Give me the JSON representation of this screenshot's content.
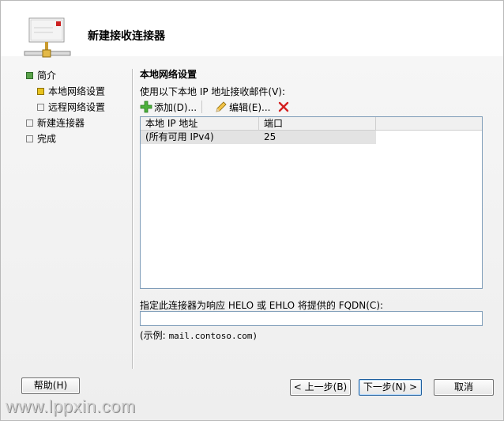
{
  "header": {
    "title": "新建接收连接器"
  },
  "nav": {
    "items": [
      {
        "label": "简介",
        "state": "complete"
      },
      {
        "label": "本地网络设置",
        "state": "current"
      },
      {
        "label": "远程网络设置",
        "state": "pending"
      },
      {
        "label": "新建连接器",
        "state": "pending"
      },
      {
        "label": "完成",
        "state": "pending"
      }
    ]
  },
  "main": {
    "section_title": "本地网络设置",
    "instruction": "使用以下本地 IP 地址接收邮件(V):",
    "toolbar": {
      "add_label": "添加(D)...",
      "edit_label": "编辑(E)..."
    },
    "grid": {
      "columns": [
        "本地 IP 地址",
        "端口"
      ],
      "rows": [
        {
          "ip": "(所有可用 IPv4)",
          "port": "25"
        }
      ]
    },
    "fqdn_label": "指定此连接器为响应 HELO 或 EHLO 将提供的 FQDN(C):",
    "fqdn_value": "",
    "example_prefix": "(示例:",
    "example_value": "mail.contoso.com)"
  },
  "footer": {
    "help_label": "帮助(H)",
    "back_label": "< 上一步(B)",
    "next_label": "下一步(N) >",
    "cancel_label": "取消"
  },
  "watermark": "www.lppxin.com",
  "colors": {
    "accent_green": "#5aa24a",
    "current_yellow": "#e7c21e",
    "delete_red": "#d42020"
  }
}
